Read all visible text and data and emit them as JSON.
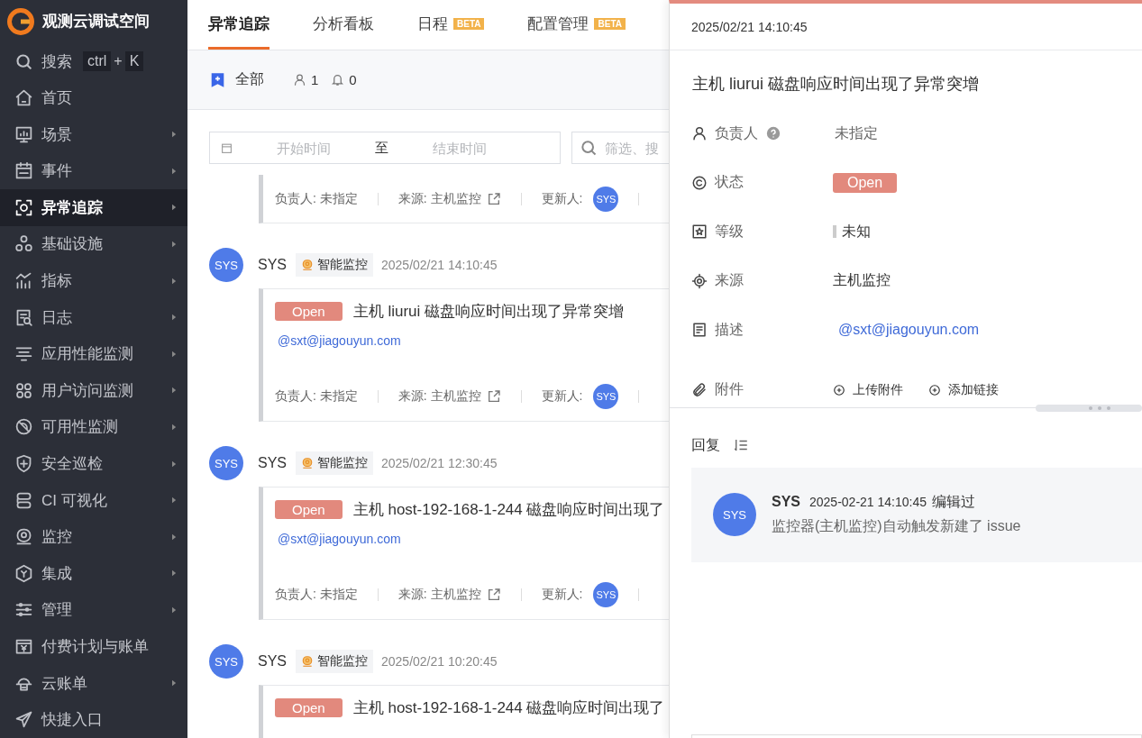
{
  "sidebar": {
    "brand": "观测云调试空间",
    "search": {
      "label": "搜索",
      "keys": [
        "ctrl",
        "+",
        "K"
      ]
    },
    "items": [
      {
        "label": "首页",
        "has_submenu": false,
        "selected": false
      },
      {
        "label": "场景",
        "has_submenu": true,
        "selected": false
      },
      {
        "label": "事件",
        "has_submenu": true,
        "selected": false
      },
      {
        "label": "异常追踪",
        "has_submenu": true,
        "selected": true
      },
      {
        "label": "基础设施",
        "has_submenu": true,
        "selected": false
      },
      {
        "label": "指标",
        "has_submenu": true,
        "selected": false
      },
      {
        "label": "日志",
        "has_submenu": true,
        "selected": false
      },
      {
        "label": "应用性能监测",
        "has_submenu": true,
        "selected": false
      },
      {
        "label": "用户访问监测",
        "has_submenu": true,
        "selected": false
      },
      {
        "label": "可用性监测",
        "has_submenu": true,
        "selected": false
      },
      {
        "label": "安全巡检",
        "has_submenu": true,
        "selected": false
      },
      {
        "label": "CI 可视化",
        "has_submenu": true,
        "selected": false
      },
      {
        "label": "监控",
        "has_submenu": true,
        "selected": false
      },
      {
        "label": "集成",
        "has_submenu": true,
        "selected": false
      },
      {
        "label": "管理",
        "has_submenu": true,
        "selected": false
      },
      {
        "label": "付费计划与账单",
        "has_submenu": false,
        "selected": false
      },
      {
        "label": "云账单",
        "has_submenu": true,
        "selected": false
      },
      {
        "label": "快捷入口",
        "has_submenu": false,
        "selected": false
      }
    ]
  },
  "tabs": [
    {
      "label": "异常追踪",
      "selected": true
    },
    {
      "label": "分析看板",
      "selected": false
    },
    {
      "label": "日程",
      "badge": "BETA",
      "selected": false
    },
    {
      "label": "配置管理",
      "badge": "BETA",
      "selected": false
    }
  ],
  "filter_bar": {
    "view": "全部",
    "assignee_count": "1",
    "notify_count": "0"
  },
  "date_range": {
    "start_placeholder": "开始时间",
    "separator": "至",
    "end_placeholder": "结束时间"
  },
  "search": {
    "placeholder": "筛选、搜"
  },
  "issues": [
    {
      "footer": {
        "assignee": "负责人: 未指定",
        "source": "来源: 主机监控",
        "updater_label": "更新人:",
        "updater": "SYS"
      }
    },
    {
      "avatar": "SYS",
      "author": "SYS",
      "tag": "智能监控",
      "time": "2025/02/21 14:10:45",
      "status": "Open",
      "title": "主机 liurui 磁盘响应时间出现了异常突增",
      "mention": "@sxt@jiagouyun.com",
      "footer": {
        "assignee": "负责人: 未指定",
        "source": "来源: 主机监控",
        "updater_label": "更新人:",
        "updater": "SYS"
      }
    },
    {
      "avatar": "SYS",
      "author": "SYS",
      "tag": "智能监控",
      "time": "2025/02/21 12:30:45",
      "status": "Open",
      "title": "主机 host-192-168-1-244 磁盘响应时间出现了",
      "mention": "@sxt@jiagouyun.com",
      "footer": {
        "assignee": "负责人: 未指定",
        "source": "来源: 主机监控",
        "updater_label": "更新人:",
        "updater": "SYS"
      }
    },
    {
      "avatar": "SYS",
      "author": "SYS",
      "tag": "智能监控",
      "time": "2025/02/21 10:20:45",
      "status": "Open",
      "title": "主机 host-192-168-1-244 磁盘响应时间出现了"
    }
  ],
  "drawer": {
    "time": "2025/02/21 14:10:45",
    "title": "主机 liurui 磁盘响应时间出现了异常突增",
    "fields": [
      {
        "kind": "assignee",
        "label": "负责人",
        "value": "未指定"
      },
      {
        "kind": "status",
        "label": "状态",
        "value": "Open"
      },
      {
        "kind": "level",
        "label": "等级",
        "value": "未知"
      },
      {
        "kind": "source",
        "label": "来源",
        "value": "主机监控"
      },
      {
        "kind": "description",
        "label": "描述",
        "value": "@sxt@jiagouyun.com"
      },
      {
        "kind": "attachments",
        "label": "附件",
        "actions": [
          "上传附件",
          "添加链接"
        ]
      }
    ],
    "reply_title": "回复",
    "comments": [
      {
        "avatar": "SYS",
        "author": "SYS",
        "time": "2025-02-21 14:10:45",
        "edited": "编辑过",
        "text": "监控器(主机监控)自动触发新建了 issue"
      }
    ]
  }
}
